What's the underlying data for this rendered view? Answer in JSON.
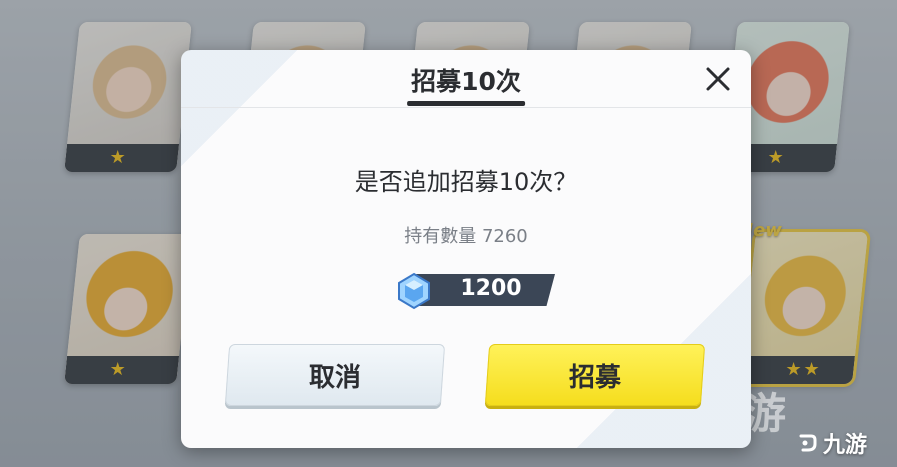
{
  "background": {
    "cards_top": [
      {
        "stars": 1,
        "style": "blonde"
      },
      {
        "stars": 0,
        "style": "blonde"
      },
      {
        "stars": 0,
        "style": "blonde"
      },
      {
        "stars": 0,
        "style": "blonde"
      },
      {
        "stars": 1,
        "style": "pink"
      }
    ],
    "cards_bottom": [
      {
        "stars": 1,
        "style": "orange"
      },
      {
        "stars": 2,
        "style": "gold"
      }
    ],
    "new_badge": "New",
    "star_glyph": "★",
    "star_color": "#f5c524"
  },
  "dialog": {
    "title": "招募10次",
    "close_icon": "close-icon",
    "question": "是否追加招募10次？",
    "holding": "持有數量 7260",
    "cost": {
      "icon": "crystal-icon",
      "value": "1200"
    },
    "cancel_label": "取消",
    "confirm_label": "招募"
  },
  "watermark": {
    "text": "九游",
    "large_text": "九游"
  },
  "colors": {
    "confirm": "#f5dd1d",
    "cancel": "#dfe8ef",
    "text": "#2b2d31",
    "pill": "#3b4656"
  }
}
